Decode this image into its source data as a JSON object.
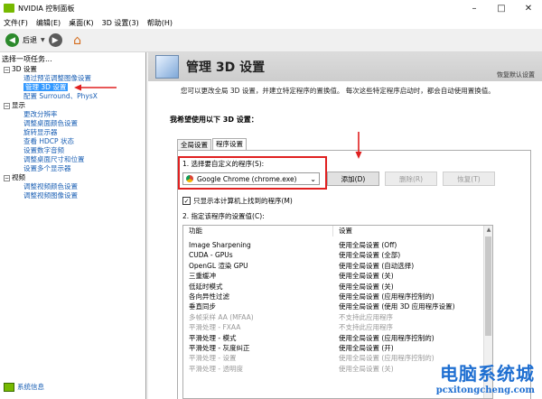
{
  "window": {
    "title": "NVIDIA 控制面板",
    "controls": [
      "–",
      "□",
      "✕"
    ]
  },
  "menu": [
    "文件(F)",
    "编辑(E)",
    "桌面(K)",
    "3D 设置(3)",
    "帮助(H)"
  ],
  "toolbar": {
    "back_label": "后退"
  },
  "sidebar": {
    "task_label": "选择一项任务...",
    "groups": [
      {
        "label": "3D 设置",
        "items": [
          "通过预览调整图像设置",
          "管理 3D 设置",
          "配置 Surround、PhysX"
        ]
      },
      {
        "label": "显示",
        "items": [
          "更改分辨率",
          "调整桌面颜色设置",
          "旋转显示器",
          "查看 HDCP 状态",
          "设置数字音频",
          "调整桌面尺寸和位置",
          "设置多个显示器"
        ]
      },
      {
        "label": "视频",
        "items": [
          "调整视频颜色设置",
          "调整视频图像设置"
        ]
      }
    ],
    "system_info": "系统信息"
  },
  "panel": {
    "title": "管理 3D 设置",
    "restore": "恢复默认设置",
    "description": "您可以更改全局 3D 设置，并建立特定程序的置换值。 每次这些特定程序启动时，都会自动使用置换值。",
    "section_title": "我希望使用以下 3D 设置：",
    "tabs": [
      "全局设置",
      "程序设置"
    ],
    "step1": "1. 选择要自定义的程序(S):",
    "selected_program": "Google Chrome (chrome.exe)",
    "buttons": {
      "add": "添加(D)",
      "remove": "删除(R)",
      "restore": "恢复(T)"
    },
    "checkbox_label": "只显示本计算机上找到的程序(M)",
    "step2": "2. 指定该程序的设置值(C):",
    "grid": {
      "headers": [
        "功能",
        "设置"
      ],
      "rows": [
        {
          "feature": "Image Sharpening",
          "setting": "使用全局设置 (Off)",
          "dim": false
        },
        {
          "feature": "CUDA - GPUs",
          "setting": "使用全局设置 (全部)",
          "dim": false
        },
        {
          "feature": "OpenGL 渲染 GPU",
          "setting": "使用全局设置 (自动选择)",
          "dim": false
        },
        {
          "feature": "三重缓冲",
          "setting": "使用全局设置 (关)",
          "dim": false
        },
        {
          "feature": "低延时模式",
          "setting": "使用全局设置 (关)",
          "dim": false
        },
        {
          "feature": "各向异性过滤",
          "setting": "使用全局设置 (应用程序控制的)",
          "dim": false
        },
        {
          "feature": "垂直同步",
          "setting": "使用全局设置 (使用 3D 应用程序设置)",
          "dim": false
        },
        {
          "feature": "多帧采样 AA (MFAA)",
          "setting": "不支持此应用程序",
          "dim": true
        },
        {
          "feature": "平滑处理 - FXAA",
          "setting": "不支持此应用程序",
          "dim": true
        },
        {
          "feature": "平滑处理 - 模式",
          "setting": "使用全局设置 (应用程序控制的)",
          "dim": false
        },
        {
          "feature": "平滑处理 - 灰度纠正",
          "setting": "使用全局设置 (开)",
          "dim": false
        },
        {
          "feature": "平滑处理 - 设置",
          "setting": "使用全局设置 (应用程序控制的)",
          "dim": true
        },
        {
          "feature": "平滑处理 - 透明度",
          "setting": "使用全局设置 (关)",
          "dim": true
        }
      ]
    }
  },
  "watermark": {
    "cn": "电脑系统城",
    "en": "pcxitongcheng.com"
  }
}
